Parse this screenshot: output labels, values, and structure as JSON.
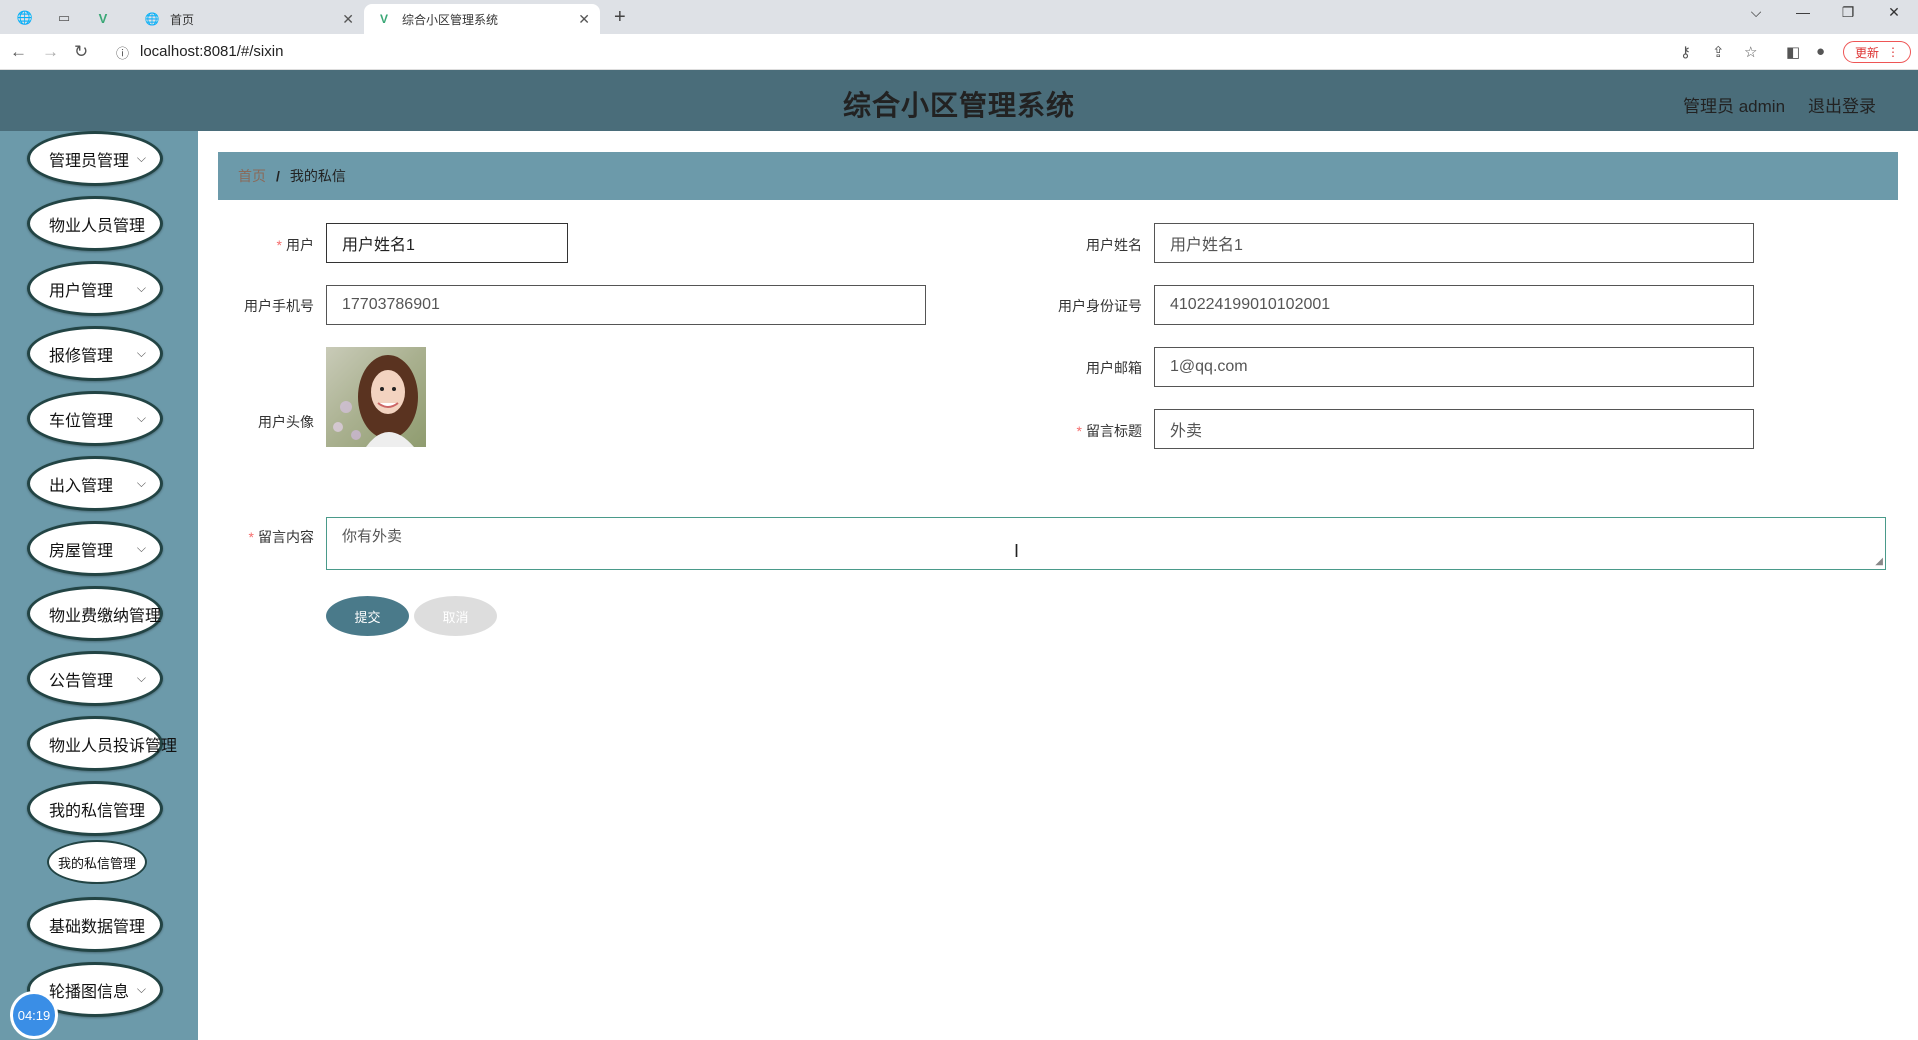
{
  "browser": {
    "tabs": [
      {
        "title": "首页",
        "active": false
      },
      {
        "title": "综合小区管理系统",
        "active": true
      }
    ],
    "url": "localhost:8081/#/sixin",
    "update_label": "更新"
  },
  "header": {
    "title": "综合小区管理系统",
    "admin_label": "管理员 admin",
    "logout_label": "退出登录",
    "bg_color": "#4a6d7a"
  },
  "sidebar": {
    "bg_color": "#6c9aaa",
    "items": [
      {
        "label": "管理员管理",
        "has_chevron": true
      },
      {
        "label": "物业人员管理",
        "has_chevron": false
      },
      {
        "label": "用户管理",
        "has_chevron": true
      },
      {
        "label": "报修管理",
        "has_chevron": true
      },
      {
        "label": "车位管理",
        "has_chevron": true
      },
      {
        "label": "出入管理",
        "has_chevron": true
      },
      {
        "label": "房屋管理",
        "has_chevron": true
      },
      {
        "label": "物业费缴纳管理",
        "has_chevron": false
      },
      {
        "label": "公告管理",
        "has_chevron": true
      },
      {
        "label": "物业人员投诉管理",
        "has_chevron": false
      },
      {
        "label": "我的私信管理",
        "has_chevron": false
      },
      {
        "label": "基础数据管理",
        "has_chevron": false
      },
      {
        "label": "轮播图信息",
        "has_chevron": true
      }
    ],
    "sub_item": "我的私信管理",
    "timer": "04:19"
  },
  "breadcrumb": {
    "home": "首页",
    "separator": "/",
    "current": "我的私信"
  },
  "form": {
    "user_label": "用户",
    "user_value": "用户姓名1",
    "name_label": "用户姓名",
    "name_value": "用户姓名1",
    "phone_label": "用户手机号",
    "phone_value": "17703786901",
    "idcard_label": "用户身份证号",
    "idcard_value": "410224199010102001",
    "avatar_label": "用户头像",
    "email_label": "用户邮箱",
    "email_value": "1@qq.com",
    "title_label": "留言标题",
    "title_value": "外卖",
    "content_label": "留言内容",
    "content_value": "你有外卖",
    "submit_label": "提交",
    "cancel_label": "取消"
  }
}
